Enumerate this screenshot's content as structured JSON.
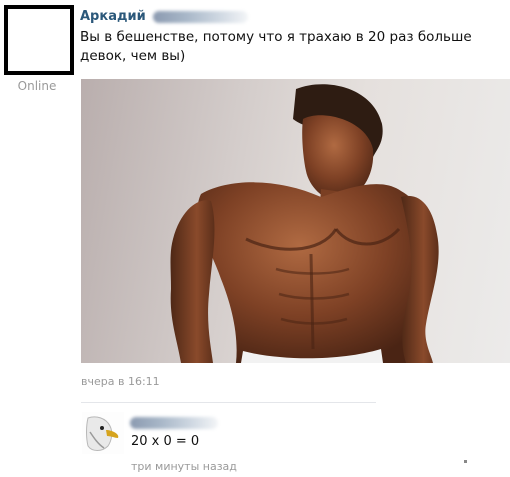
{
  "post": {
    "author_name": "Аркадий",
    "status": "Online",
    "text": "Вы в бешенстве, потому что я трахаю в 20 раз больше девок, чем вы)",
    "time": "вчера в 16:11"
  },
  "reply": {
    "text": "20 x 0 = 0",
    "time": "три минуты назад"
  },
  "colors": {
    "author_link": "#2b587a",
    "muted_text": "#9a9a9a",
    "divider": "#e4e6ea"
  }
}
